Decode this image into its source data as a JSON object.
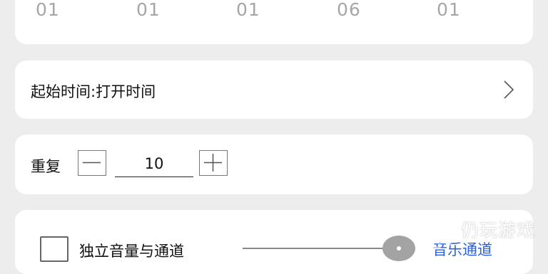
{
  "picker": {
    "values": [
      "01",
      "01",
      "01",
      "06",
      "01"
    ]
  },
  "start_time": {
    "label": "起始时间:打开时间",
    "chevron_icon": "chevron-right-icon"
  },
  "repeat": {
    "label": "重复",
    "value": "10",
    "minus_icon": "minus-icon",
    "plus_icon": "plus-icon"
  },
  "audio": {
    "checkbox_checked": false,
    "label": "独立音量与通道",
    "channel_label": "音乐通道",
    "volume_level_fraction": 1.0,
    "accent_color": "#2b5fe0"
  },
  "watermark": {
    "text": "仍玩游戏"
  }
}
